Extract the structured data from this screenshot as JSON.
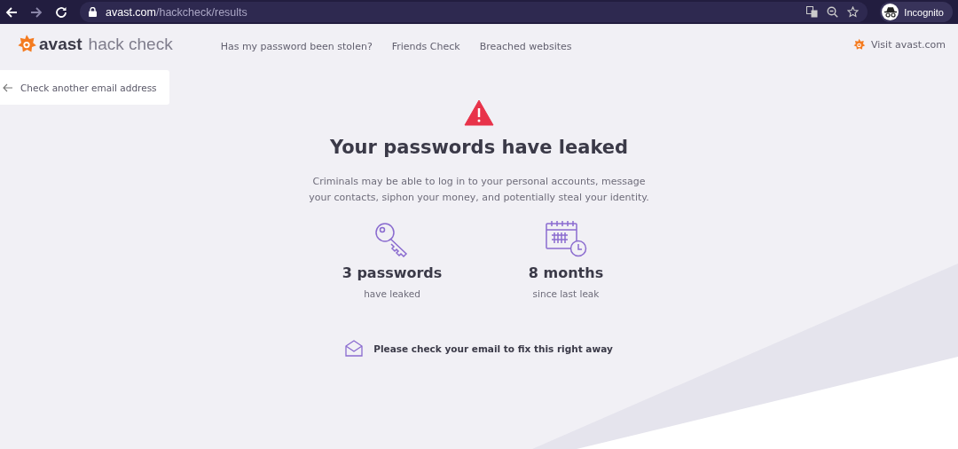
{
  "browser": {
    "url_host": "avast.com",
    "url_path": "/hackcheck/results",
    "profile": "Incognito"
  },
  "header": {
    "logo_brand": "avast",
    "logo_product": "hack check",
    "nav": [
      "Has my password been stolen?",
      "Friends Check",
      "Breached websites"
    ],
    "visit_link": "Visit avast.com"
  },
  "back_link": "Check another email address",
  "result": {
    "title": "Your passwords have leaked",
    "description": "Criminals may be able to log in to your personal accounts, message your contacts, siphon your money, and potentially steal your identity.",
    "stats": [
      {
        "kind": "key",
        "value": "3 passwords",
        "caption": "have leaked"
      },
      {
        "kind": "calendar",
        "value": "8 months",
        "caption": "since last leak"
      }
    ],
    "notice": "Please check your email to fix this right away"
  }
}
